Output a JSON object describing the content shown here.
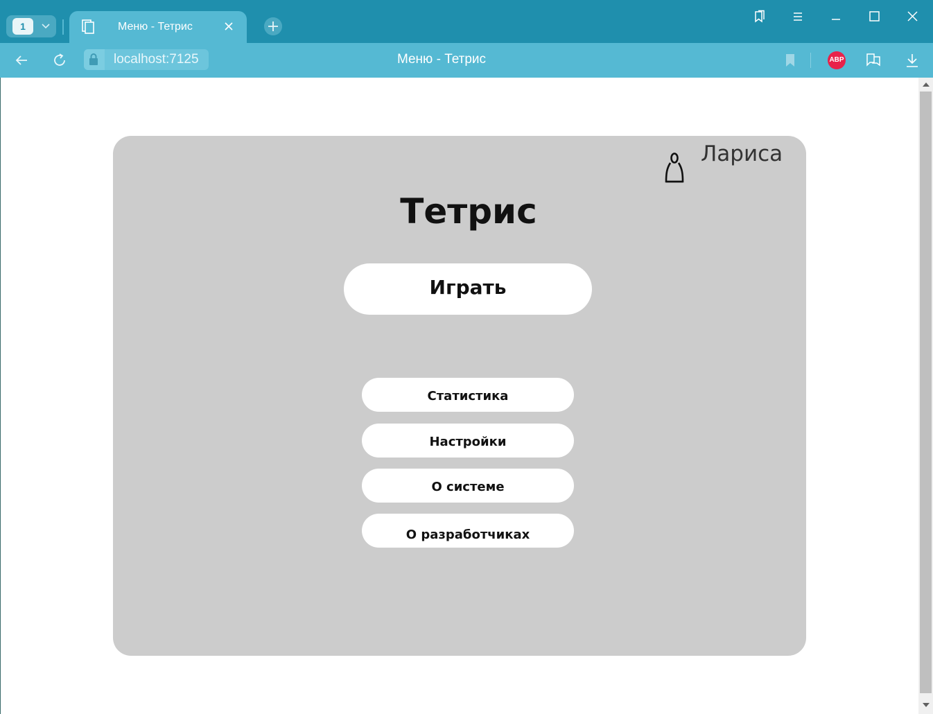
{
  "browser": {
    "tab_count": "1",
    "tab_title": "Меню - Тетрис",
    "address": "localhost:7125",
    "page_title": "Меню - Тетрис",
    "adblock_label": "ABP",
    "colors": {
      "titlebar": "#1f8fad",
      "toolbar": "#55b9d3",
      "abp": "#e8224a"
    }
  },
  "page": {
    "user_name": "Лариса",
    "title": "Тетрис",
    "play_label": "Играть",
    "menu_items": [
      {
        "label": "Статистика"
      },
      {
        "label": "Настройки"
      },
      {
        "label": "О системе"
      },
      {
        "label": "О разработчиках"
      }
    ],
    "colors": {
      "panel": "#cccccc",
      "button": "#ffffff"
    }
  }
}
